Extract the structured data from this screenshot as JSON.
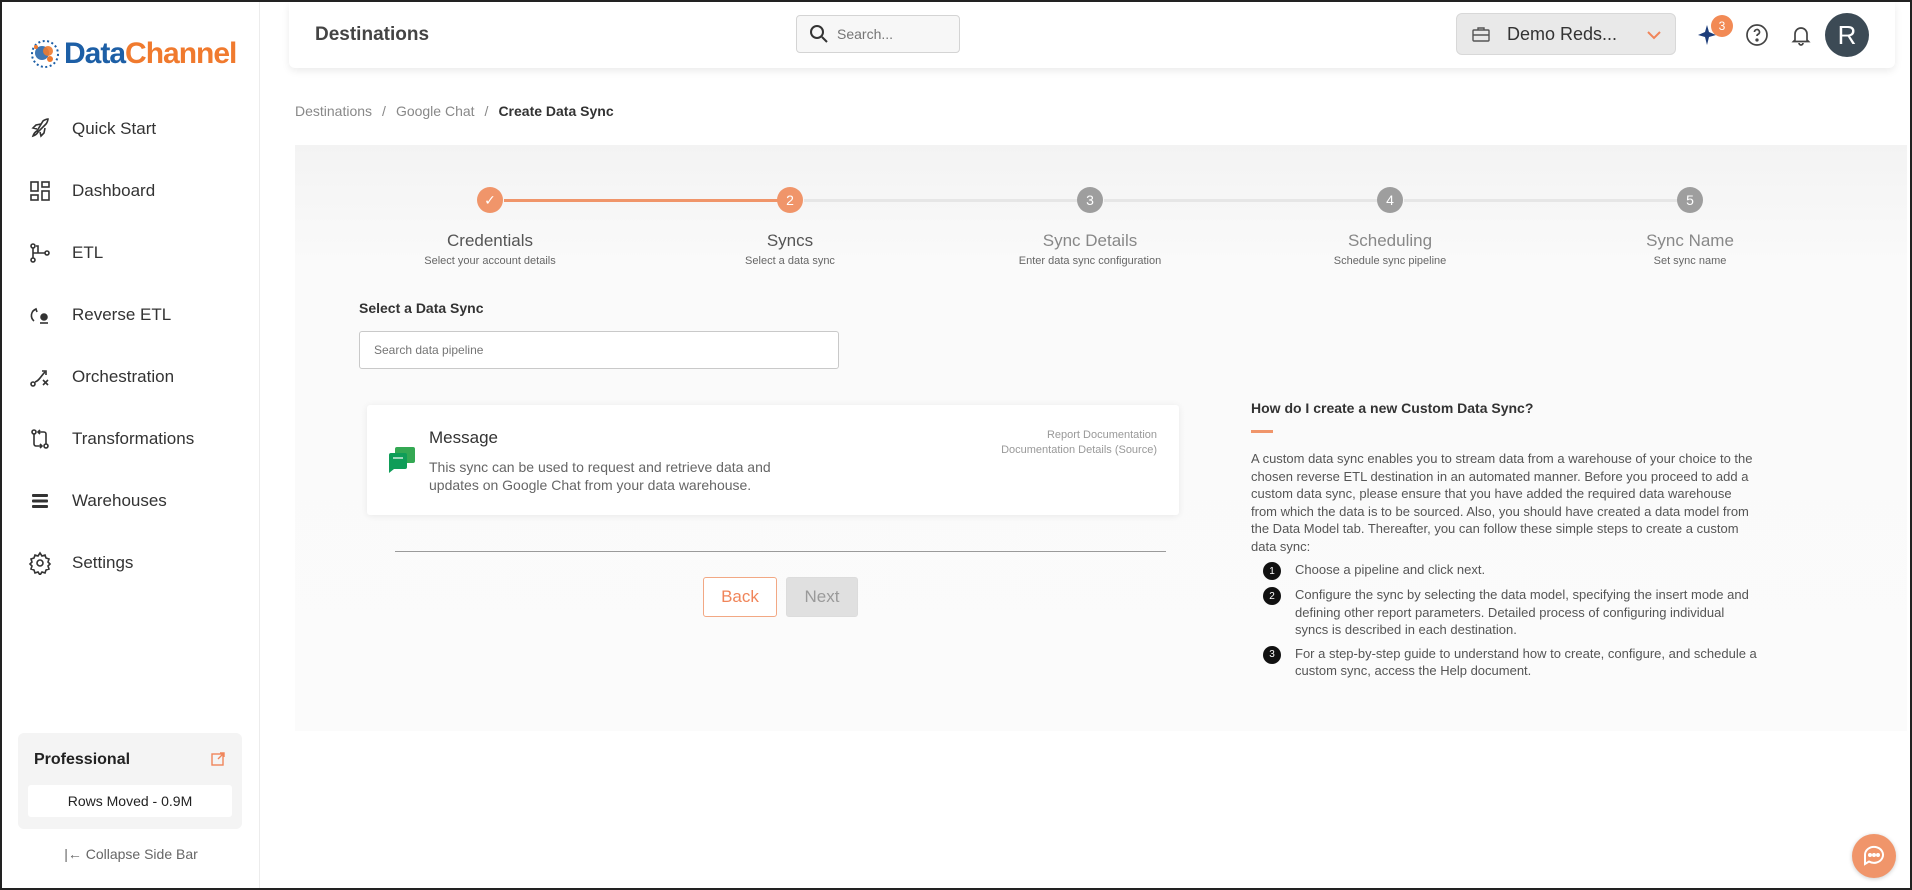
{
  "brand": {
    "part1": "Data",
    "part2": "Channel"
  },
  "sidebar": {
    "items": [
      {
        "label": "Quick Start",
        "icon": "rocket-icon"
      },
      {
        "label": "Dashboard",
        "icon": "dashboard-icon"
      },
      {
        "label": "ETL",
        "icon": "etl-icon"
      },
      {
        "label": "Reverse ETL",
        "icon": "reverse-etl-icon"
      },
      {
        "label": "Orchestration",
        "icon": "orchestration-icon"
      },
      {
        "label": "Transformations",
        "icon": "transformations-icon"
      },
      {
        "label": "Warehouses",
        "icon": "warehouses-icon"
      },
      {
        "label": "Settings",
        "icon": "gear-icon"
      }
    ],
    "plan": {
      "title": "Professional",
      "rows": "Rows Moved - 0.9M"
    },
    "collapse": "|← Collapse Side Bar"
  },
  "header": {
    "title": "Destinations",
    "search_placeholder": "Search...",
    "workspace": "Demo Reds...",
    "notif_count": "3",
    "avatar": "R"
  },
  "breadcrumb": {
    "items": [
      "Destinations",
      "Google Chat"
    ],
    "current": "Create Data Sync",
    "sep": "/"
  },
  "stepper": {
    "steps": [
      {
        "label": "Credentials",
        "sub": "Select your account details",
        "num": "✓",
        "state": "done"
      },
      {
        "label": "Syncs",
        "sub": "Select a data sync",
        "num": "2",
        "state": "active"
      },
      {
        "label": "Sync Details",
        "sub": "Enter data sync configuration",
        "num": "3",
        "state": "todo"
      },
      {
        "label": "Scheduling",
        "sub": "Schedule sync pipeline",
        "num": "4",
        "state": "todo"
      },
      {
        "label": "Sync Name",
        "sub": "Set sync name",
        "num": "5",
        "state": "todo"
      }
    ]
  },
  "main": {
    "select_title": "Select a Data Sync",
    "search_placeholder": "Search data pipeline",
    "card": {
      "title": "Message",
      "desc": "This sync can be used to request and retrieve data and updates on Google Chat from your data warehouse.",
      "link1": "Report Documentation",
      "link2": "Documentation Details (Source)"
    },
    "back": "Back",
    "next": "Next"
  },
  "help": {
    "question": "How do I create a new Custom Data Sync?",
    "para": "A custom data sync enables you to stream data from a warehouse of your choice to the chosen reverse ETL destination in an automated manner. Before you proceed to add a custom data sync, please ensure that you have added the required data warehouse from which the data is to be sourced. Also, you should have created a data model from the Data Model tab. Thereafter, you can follow these simple steps to create a custom data sync:",
    "steps": [
      "Choose a pipeline and click next.",
      "Configure the sync by selecting the data model, specifying the insert mode and defining other report parameters. Detailed process of configuring individual syncs is described in each destination.",
      "For a step-by-step guide to understand how to create, configure, and schedule a custom sync, access the Help document."
    ]
  },
  "colors": {
    "accent": "#f0956a",
    "brand_blue": "#1d5fa6",
    "brand_orange": "#f07a2e"
  }
}
